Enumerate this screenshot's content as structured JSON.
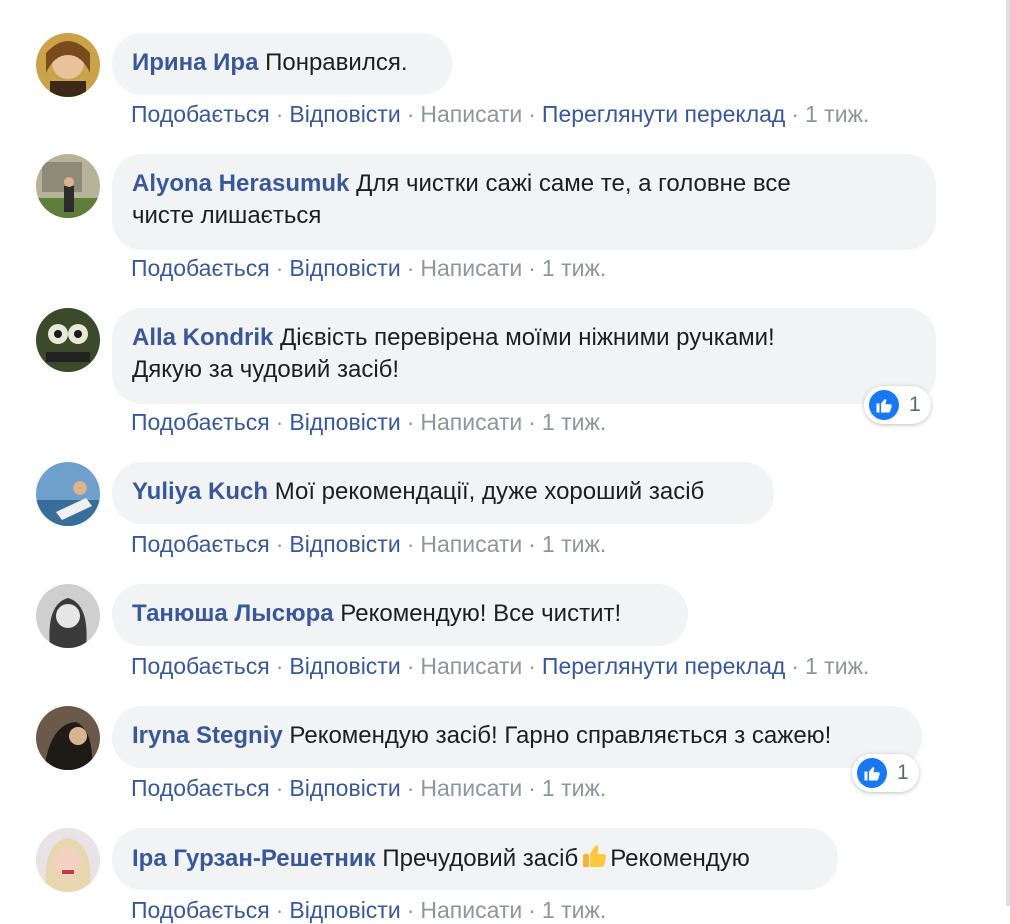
{
  "top_cut_text": "— — — — — — — — — — — — — — — — — — — — — — —",
  "labels": {
    "like": "Подобається",
    "reply": "Відповісти",
    "write": "Написати",
    "translate": "Переглянути переклад",
    "dot": "·"
  },
  "comments": [
    {
      "author": "Ирина Ира",
      "text": "Понравился.",
      "time": "1 тиж.",
      "translate": true
    },
    {
      "author": "Alyona Herasumuk",
      "text": "Для чистки сажі саме те, а головне все",
      "text2": "чисте лишається",
      "time": "1 тиж."
    },
    {
      "author": "Alla Kondrik",
      "text": "Дієвість перевірена моїми ніжними ручками!",
      "text2": "Дякую за чудовий засіб!",
      "time": "1 тиж.",
      "reactions": "1"
    },
    {
      "author": "Yuliya Kuch",
      "text": "Мої рекомендації, дуже хороший засіб",
      "time": "1 тиж."
    },
    {
      "author": "Танюша Лысюра",
      "text": "Рекомендую! Все чистит!",
      "time": "1 тиж.",
      "translate": true
    },
    {
      "author": "Iryna Stegniy",
      "text": "Рекомендую засіб! Гарно справляється з сажею!",
      "time": "1 тиж.",
      "reactions": "1"
    },
    {
      "author": "Іра Гурзан-Решетник",
      "text": "Пречудовий засіб",
      "text_after": "Рекомендую",
      "emoji": "thumbs-up-emoji",
      "time": "1 тиж."
    }
  ],
  "colors": {
    "author": "#385898",
    "bubble": "#f2f3f5",
    "text": "#1c1e21",
    "muted": "#90949c",
    "like_blue": "#1877f2"
  }
}
